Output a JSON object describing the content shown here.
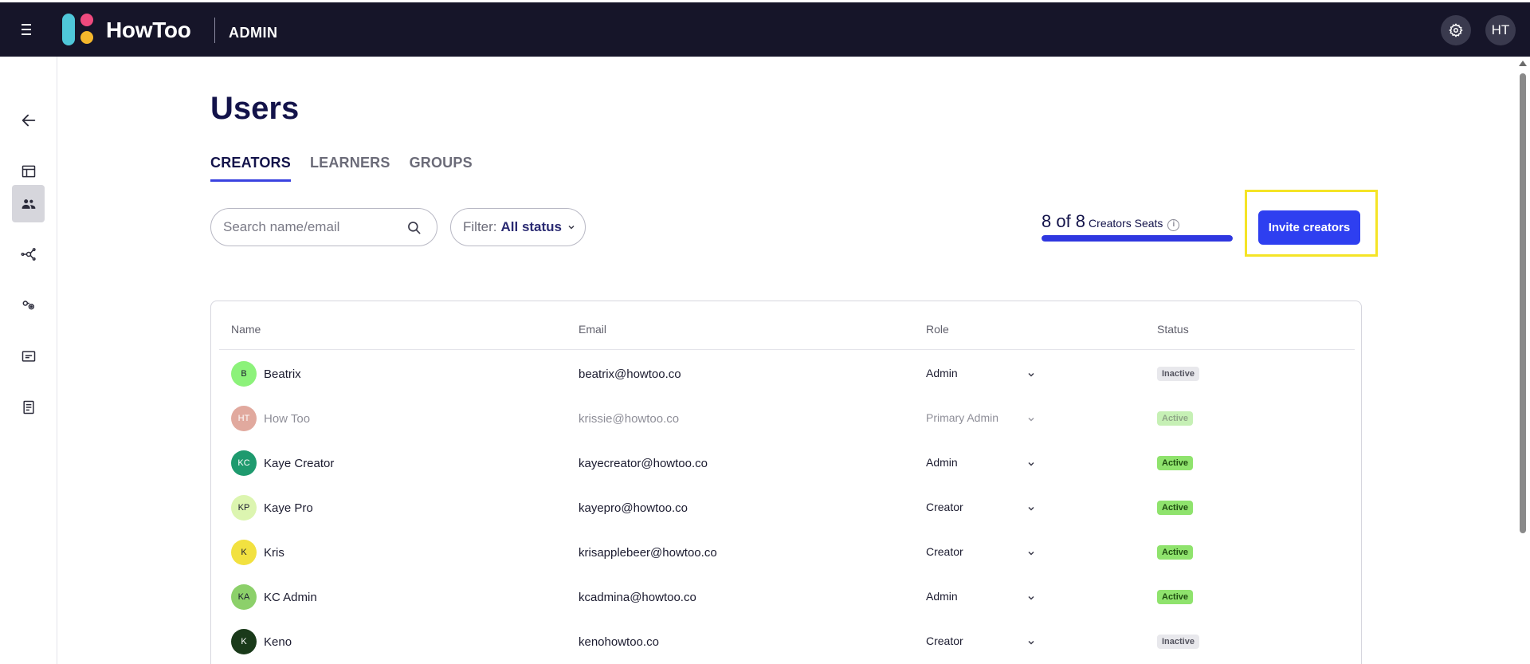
{
  "header": {
    "brand": "HowToo",
    "section": "ADMIN",
    "user_initials": "HT",
    "colors": {
      "bar": "#161529",
      "logo_bar": "#4fc7d9",
      "logo_dot_pink": "#ef4a7e",
      "logo_dot_yellow": "#f5b72c"
    }
  },
  "sidebar": {
    "items": [
      {
        "icon": "arrow-left-icon"
      },
      {
        "icon": "layout-icon"
      },
      {
        "icon": "users-icon",
        "active": true
      },
      {
        "icon": "network-icon"
      },
      {
        "icon": "settings-keys-icon"
      },
      {
        "icon": "media-icon"
      },
      {
        "icon": "report-icon"
      }
    ]
  },
  "page": {
    "title": "Users",
    "tabs": [
      {
        "label": "CREATORS",
        "active": true
      },
      {
        "label": "LEARNERS"
      },
      {
        "label": "GROUPS"
      }
    ]
  },
  "toolbar": {
    "search_placeholder": "Search name/email",
    "filter_label": "Filter:",
    "filter_value": "All status",
    "seats_count": "8 of 8",
    "seats_label": "Creators Seats",
    "seats_info": "i",
    "seats_used_fraction": 1.0,
    "invite_label": "Invite creators",
    "accent": "#2e3ff0"
  },
  "table": {
    "columns": [
      "Name",
      "Email",
      "Role",
      "Status"
    ],
    "rows": [
      {
        "initials": "B",
        "name": "Beatrix",
        "email": "beatrix@howtoo.co",
        "role": "Admin",
        "status": "Inactive",
        "avatar_color": "#8cf27a",
        "dim": false
      },
      {
        "initials": "HT",
        "name": "How Too",
        "email": "krissie@howtoo.co",
        "role": "Primary Admin",
        "status": "Active",
        "avatar_color": "#c4553f",
        "dim": true
      },
      {
        "initials": "KC",
        "name": "Kaye Creator",
        "email": "kayecreator@howtoo.co",
        "role": "Admin",
        "status": "Active",
        "avatar_color": "#1e9a6e",
        "dim": false
      },
      {
        "initials": "KP",
        "name": "Kaye Pro",
        "email": "kayepro@howtoo.co",
        "role": "Creator",
        "status": "Active",
        "avatar_color": "#dcf5b0",
        "dim": false
      },
      {
        "initials": "K",
        "name": "Kris",
        "email": "krisapplebeer@howtoo.co",
        "role": "Creator",
        "status": "Active",
        "avatar_color": "#f2e140",
        "dim": false
      },
      {
        "initials": "KA",
        "name": "KC Admin",
        "email": "kcadmina@howtoo.co",
        "role": "Admin",
        "status": "Active",
        "avatar_color": "#8cd06a",
        "dim": false
      },
      {
        "initials": "K",
        "name": "Keno",
        "email": "kenohowtoo.co",
        "role": "Creator",
        "status": "Inactive",
        "avatar_color": "#1a3a1a",
        "dim": false
      }
    ]
  }
}
